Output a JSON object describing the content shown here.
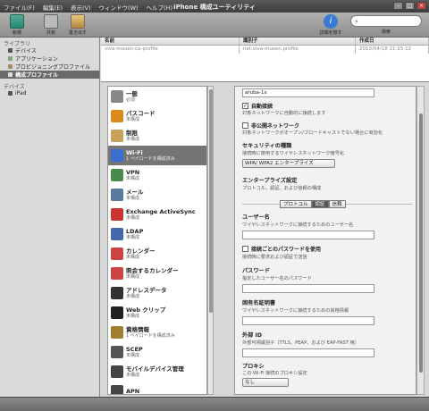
{
  "titlebar": {
    "menus": [
      "ファイル(F)",
      "編集(E)",
      "表示(V)",
      "ウィンドウ(W)",
      "ヘルプ(H)"
    ],
    "title": "iPhone 構成ユーティリティ"
  },
  "toolbar": {
    "new": "新規",
    "share": "共有",
    "export": "書き出す",
    "info": "詳細を隠す",
    "search_label": "検索",
    "search_placeholder": ""
  },
  "sidebar": {
    "library_header": "ライブラリ",
    "library_items": [
      "デバイス",
      "アプリケーション",
      "プロビジョニングプロファイル",
      "構成プロファイル"
    ],
    "devices_header": "デバイス",
    "device_items": [
      "iPad"
    ]
  },
  "table": {
    "headers": [
      "名前",
      "識別子",
      "作成日"
    ],
    "rows": [
      [
        "viva-musen-ca-profile",
        "net.viva-musen.profile",
        "2013/04/18 21:15:12"
      ]
    ]
  },
  "categories": [
    {
      "name": "一般",
      "status": "必須",
      "icon": "settings-icon",
      "color": "#888"
    },
    {
      "name": "パスコード",
      "status": "未構成",
      "icon": "key-icon",
      "color": "#d98a1a"
    },
    {
      "name": "制限",
      "status": "未構成",
      "icon": "lock-icon",
      "color": "#c9a25a"
    },
    {
      "name": "Wi-Fi",
      "status": "1 ペイロードを構成済み",
      "icon": "wifi-icon",
      "color": "#3a6fd0"
    },
    {
      "name": "VPN",
      "status": "未構成",
      "icon": "vpn-icon",
      "color": "#4a8a4a"
    },
    {
      "name": "メール",
      "status": "未構成",
      "icon": "mail-icon",
      "color": "#5a7aa0"
    },
    {
      "name": "Exchange ActiveSync",
      "status": "未構成",
      "icon": "exchange-icon",
      "color": "#cc3333"
    },
    {
      "name": "LDAP",
      "status": "未構成",
      "icon": "ldap-icon",
      "color": "#4466aa"
    },
    {
      "name": "カレンダー",
      "status": "未構成",
      "icon": "calendar-icon",
      "color": "#c44"
    },
    {
      "name": "照会するカレンダー",
      "status": "未構成",
      "icon": "subscribed-calendar-icon",
      "color": "#c44"
    },
    {
      "name": "アドレスデータ",
      "status": "未構成",
      "icon": "contacts-icon",
      "color": "#333"
    },
    {
      "name": "Web クリップ",
      "status": "未構成",
      "icon": "webclip-icon",
      "color": "#222"
    },
    {
      "name": "資格情報",
      "status": "1 ペイロードを構成済み",
      "icon": "certificate-icon",
      "color": "#a08030"
    },
    {
      "name": "SCEP",
      "status": "未構成",
      "icon": "scep-icon",
      "color": "#555"
    },
    {
      "name": "モバイルデバイス管理",
      "status": "未構成",
      "icon": "mdm-icon",
      "color": "#444"
    },
    {
      "name": "APN",
      "status": "",
      "icon": "apn-icon",
      "color": "#444"
    }
  ],
  "detail": {
    "ssid_value": "aruba-1x",
    "auto_join": {
      "label": "自動接続",
      "desc": "対象ネットワークに自動的に接続します",
      "checked": true
    },
    "hidden": {
      "label": "非公開ネットワーク",
      "desc": "対象ネットワークがオープン/ブロードキャストでない場合に有効化",
      "checked": false
    },
    "security": {
      "label": "セキュリティの種類",
      "desc": "接続時に使用するワイヤレスネットワーク暗号化",
      "value": "WPA/ WPA2 エンタープライズ"
    },
    "enterprise": {
      "label": "エンタープライズ設定",
      "desc": "プロトコル、認証、および信頼の構成",
      "tabs": [
        "プロトコル",
        "認証",
        "信頼"
      ]
    },
    "username": {
      "label": "ユーザー名",
      "desc": "ワイヤレスネットワークに接続するためのユーザー名"
    },
    "per_conn": {
      "label": "接続ごとのパスワードを使用",
      "desc": "接続時に要求および認証で送信",
      "checked": false
    },
    "password": {
      "label": "パスワード",
      "desc": "指定したユーザー名のパスワード"
    },
    "identity_cert": {
      "label": "固有名証明書",
      "desc": "ワイヤレスネットワークに接続するための資格情報",
      "value": ""
    },
    "outer_id": {
      "label": "外部 ID",
      "desc": "外部可視識別子（TTLS、PEAP、および EAP-FAST 用）"
    },
    "proxy": {
      "label": "プロキシ",
      "desc": "この Wi-Fi 接続のプロキシ設定",
      "value": "なし"
    }
  }
}
